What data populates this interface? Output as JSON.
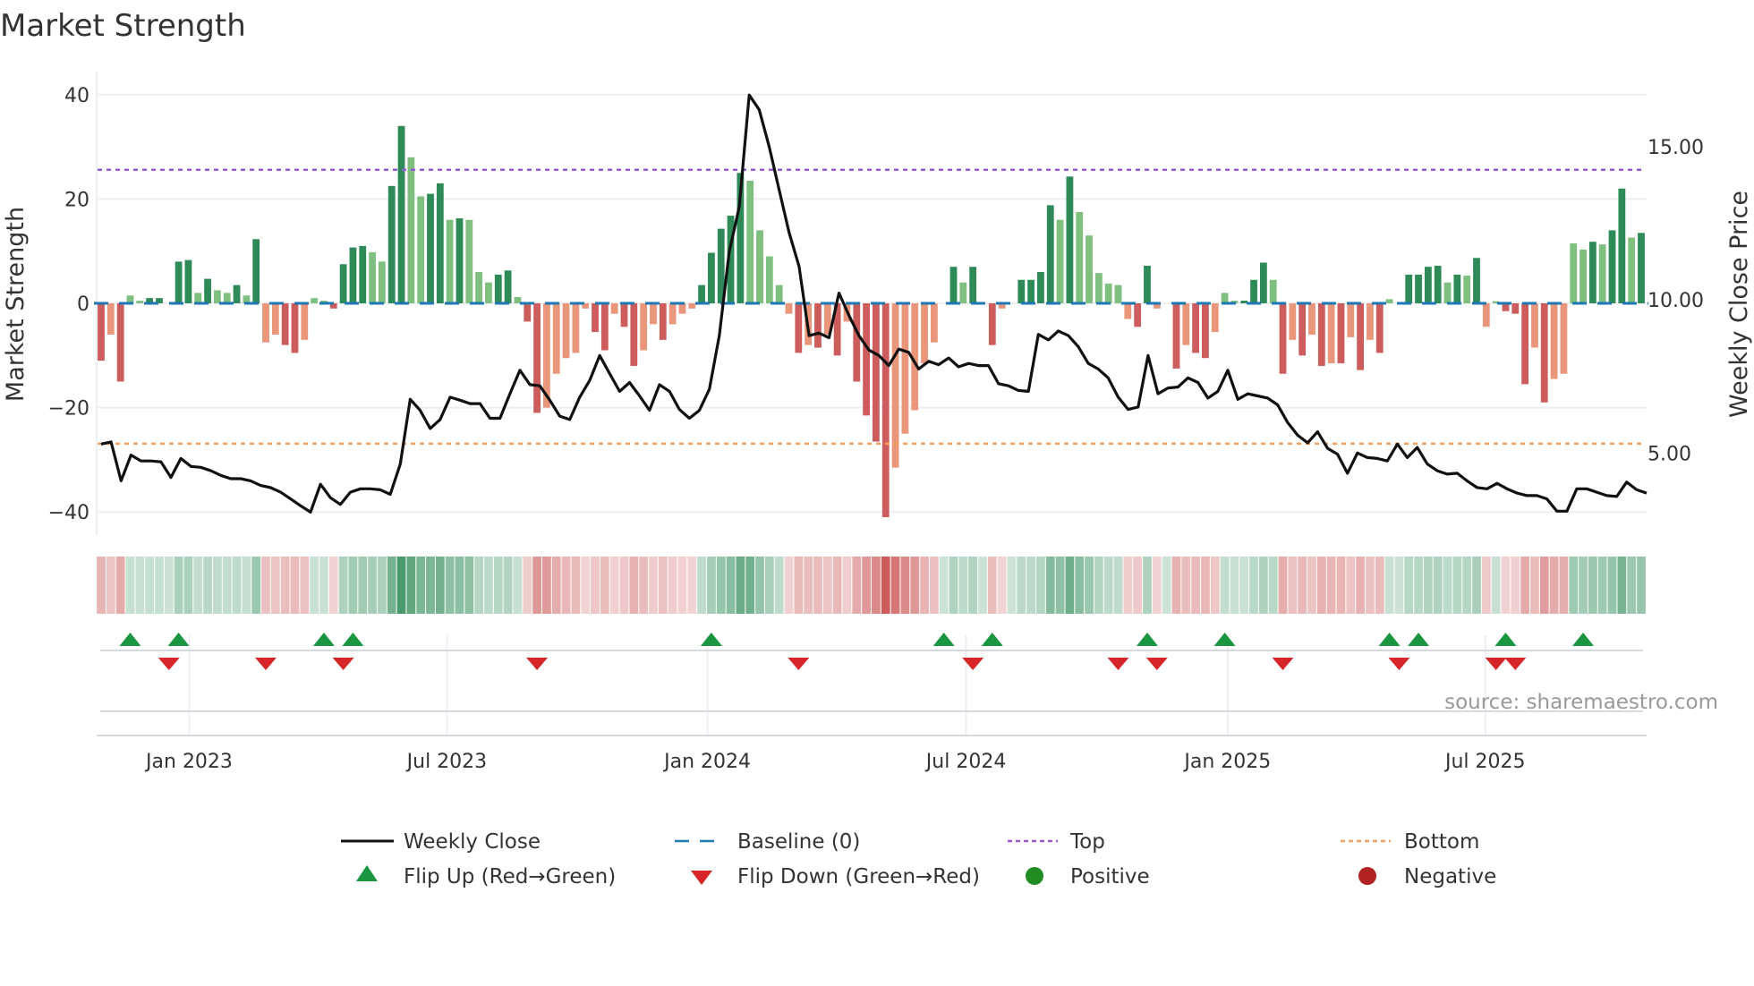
{
  "chart_data": {
    "type": "bar",
    "title": "Market Strength",
    "ylabel": "Market Strength",
    "y2label": "Weekly Close Price",
    "ylim": [
      -42,
      42
    ],
    "y2lim": [
      3.0,
      17.0
    ],
    "y_ticks": [
      "40",
      "20",
      "0",
      "−20",
      "−40"
    ],
    "y_tick_values": [
      40,
      20,
      0,
      -20,
      -40
    ],
    "y2_ticks": [
      "15.00",
      "10.00",
      "5.00"
    ],
    "y2_tick_values": [
      15,
      10,
      5
    ],
    "top_level": 25.6,
    "bottom_level": -26.9,
    "x_ticks": [
      {
        "label": "Jan 2023",
        "week": 9.1
      },
      {
        "label": "Jul 2023",
        "week": 35.7
      },
      {
        "label": "Jan 2024",
        "week": 62.6
      },
      {
        "label": "Jul 2024",
        "week": 89.3
      },
      {
        "label": "Jan 2025",
        "week": 116.3
      },
      {
        "label": "Jul 2025",
        "week": 142.9
      }
    ],
    "strength": [
      -11,
      -6,
      -15,
      1.5,
      0.5,
      1,
      1,
      0,
      8,
      8.3,
      2,
      4.7,
      2.5,
      2,
      3.5,
      1.5,
      12.3,
      -7.5,
      -6,
      -8,
      -9.5,
      -7,
      1,
      0.5,
      -1,
      7.5,
      10.7,
      11,
      9.8,
      8,
      22.5,
      34,
      28,
      20.5,
      21,
      23,
      16,
      16.3,
      16,
      6,
      4,
      5.5,
      6.3,
      1.2,
      -3.5,
      -21,
      -20,
      -13.5,
      -10.5,
      -9.5,
      -1,
      -5.5,
      -9,
      -2,
      -4.5,
      -12,
      -9,
      -4,
      -7,
      -4,
      -2,
      -1,
      3.5,
      9.7,
      14.3,
      16.8,
      25,
      23.5,
      14,
      9,
      3.5,
      -2,
      -9.5,
      -8,
      -8.5,
      -6,
      -10,
      -3.5,
      -15,
      -21.5,
      -26.5,
      -41,
      -31.5,
      -25,
      -20.5,
      -11.5,
      -7.5,
      0,
      7,
      4,
      7,
      0,
      -8,
      -1,
      0,
      4.5,
      4.5,
      6,
      18.8,
      16,
      24.3,
      17.5,
      13,
      5.8,
      3.8,
      3.5,
      -3,
      -4.5,
      7.2,
      -1,
      0,
      -12.5,
      -8,
      -9.5,
      -10.5,
      -5.5,
      2,
      0.5,
      0.5,
      4.5,
      7.8,
      4.5,
      -13.5,
      -7,
      -10,
      -6,
      -12,
      -11.5,
      -11.5,
      -6.5,
      -12.8,
      -7,
      -9.5,
      0.8,
      0,
      5.5,
      5.5,
      7,
      7.2,
      4,
      5.5,
      5.3,
      8.7,
      -4.5,
      0.4,
      -1.5,
      -2,
      -15.5,
      -8.5,
      -19,
      -14.5,
      -13.5,
      11.5,
      10.3,
      11.8,
      11.3,
      14,
      22,
      12.6,
      13.5
    ],
    "weekly_close": [
      5.29,
      5.36,
      4.09,
      4.93,
      4.74,
      4.74,
      4.71,
      4.2,
      4.82,
      4.56,
      4.53,
      4.42,
      4.27,
      4.16,
      4.16,
      4.09,
      3.94,
      3.87,
      3.72,
      3.5,
      3.28,
      3.07,
      3.98,
      3.54,
      3.32,
      3.72,
      3.83,
      3.83,
      3.8,
      3.65,
      4.64,
      6.75,
      6.39,
      5.8,
      6.09,
      6.82,
      6.72,
      6.61,
      6.61,
      6.13,
      6.13,
      6.93,
      7.7,
      7.23,
      7.19,
      6.72,
      6.2,
      6.09,
      6.82,
      7.37,
      8.18,
      7.59,
      7.01,
      7.3,
      6.86,
      6.39,
      7.23,
      7.01,
      6.42,
      6.13,
      6.39,
      7.08,
      8.83,
      11.57,
      13.03,
      16.68,
      16.2,
      15.0,
      13.58,
      12.19,
      11.09,
      8.83,
      8.91,
      8.76,
      10.22,
      9.49,
      8.83,
      8.36,
      8.18,
      7.85,
      8.39,
      8.28,
      7.74,
      7.99,
      7.88,
      8.1,
      7.81,
      7.92,
      7.85,
      7.85,
      7.26,
      7.19,
      7.04,
      7.01,
      8.87,
      8.69,
      8.98,
      8.83,
      8.47,
      7.92,
      7.74,
      7.45,
      6.82,
      6.42,
      6.5,
      8.18,
      6.93,
      7.12,
      7.15,
      7.45,
      7.3,
      6.79,
      7.01,
      7.7,
      6.75,
      6.93,
      6.86,
      6.79,
      6.57,
      5.99,
      5.58,
      5.33,
      5.69,
      5.15,
      4.96,
      4.34,
      5.0,
      4.85,
      4.82,
      4.74,
      5.29,
      4.85,
      5.18,
      4.64,
      4.42,
      4.31,
      4.34,
      4.09,
      3.87,
      3.83,
      4.01,
      3.83,
      3.69,
      3.61,
      3.61,
      3.5,
      3.1,
      3.1,
      3.83,
      3.83,
      3.72,
      3.61,
      3.58,
      4.05,
      3.8,
      3.69
    ],
    "flip_up_weeks": [
      3,
      8,
      23,
      26,
      63,
      87,
      92,
      108,
      116,
      133,
      136,
      145,
      153
    ],
    "flip_down_weeks": [
      7,
      17,
      25,
      45,
      72,
      90,
      105,
      109,
      122,
      134,
      144,
      146
    ],
    "legend": [
      {
        "label": "Weekly Close",
        "icon": "solid-line"
      },
      {
        "label": "Baseline (0)",
        "icon": "dashed-line"
      },
      {
        "label": "Top",
        "icon": "dotted-line"
      },
      {
        "label": "Bottom",
        "icon": "dotted-line"
      },
      {
        "label": "Flip Up (Red→Green)",
        "icon": "triangle-up"
      },
      {
        "label": "Flip Down (Green→Red)",
        "icon": "triangle-down"
      },
      {
        "label": "Positive",
        "icon": "circle"
      },
      {
        "label": "Negative",
        "icon": "circle"
      }
    ],
    "colors": {
      "pos_strong": "#2e8b57",
      "pos_weak": "#7fbf7f",
      "neg_strong": "#cd5c5c",
      "neg_weak": "#e9967a",
      "baseline": "#1f77b4",
      "top": "#9b59d6",
      "bottom": "#f0a060",
      "flip_up": "#1a9641",
      "flip_down": "#d7262a",
      "positive_dot": "#228b22",
      "negative_dot": "#b22222"
    }
  },
  "source": "source: sharemaestro.com"
}
